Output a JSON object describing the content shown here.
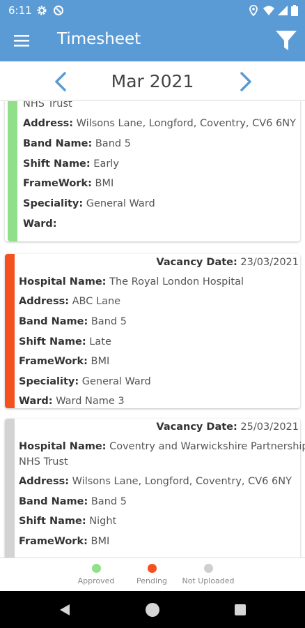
{
  "status_bar": {
    "time": "6:11",
    "icons_left": [
      "gear-icon",
      "data-saver-icon"
    ],
    "icons_right": [
      "location-icon",
      "wifi-icon",
      "signal-icon",
      "battery-icon"
    ]
  },
  "app_bar": {
    "title": "Timesheet",
    "menu_icon": "hamburger-menu-icon",
    "filter_icon": "filter-icon",
    "background": "#5b9bd5"
  },
  "month_nav": {
    "label": "Mar 2021",
    "prev_icon": "chevron-left-icon",
    "next_icon": "chevron-right-icon",
    "arrow_color": "#5b9bd5"
  },
  "cards": [
    {
      "status": "approved",
      "color": "#90e08a",
      "hospital_cont": "NHS Trust",
      "address_label": "Address:",
      "address": "Wilsons Lane, Longford, Coventry, CV6 6NY",
      "band_label": "Band Name:",
      "band": "Band 5",
      "shift_label": "Shift Name:",
      "shift": "Early",
      "framework_label": "FrameWork:",
      "framework": "BMI",
      "speciality_label": "Speciality:",
      "speciality": "General Ward",
      "ward_label": "Ward:",
      "ward": ""
    },
    {
      "status": "pending",
      "color": "#f4511e",
      "vacancy_label": "Vacancy Date:",
      "vacancy_date": "23/03/2021",
      "hospital_label": "Hospital Name:",
      "hospital": "The Royal London Hospital",
      "address_label": "Address:",
      "address": "ABC Lane",
      "band_label": "Band Name:",
      "band": "Band 5",
      "shift_label": "Shift Name:",
      "shift": "Late",
      "framework_label": "FrameWork:",
      "framework": "BMI",
      "speciality_label": "Speciality:",
      "speciality": "General Ward",
      "ward_label": "Ward:",
      "ward": "Ward Name 3"
    },
    {
      "status": "not-uploaded",
      "color": "#d3d3d3",
      "vacancy_label": "Vacancy Date:",
      "vacancy_date": "25/03/2021",
      "hospital_label": "Hospital Name:",
      "hospital": "Coventry and Warwickshire Partnership",
      "hospital_cont": "NHS Trust",
      "address_label": "Address:",
      "address": "Wilsons Lane, Longford, Coventry, CV6 6NY",
      "band_label": "Band Name:",
      "band": "Band 5",
      "shift_label": "Shift Name:",
      "shift": "Night",
      "framework_label": "FrameWork:",
      "framework": "BMI"
    }
  ],
  "legend": [
    {
      "label": "Approved",
      "color": "#90e08a"
    },
    {
      "label": "Pending",
      "color": "#f4511e"
    },
    {
      "label": "Not Uploaded",
      "color": "#cfcfcf"
    }
  ],
  "nav_bar": {
    "icons": [
      "back-icon",
      "home-icon",
      "recents-icon"
    ]
  }
}
